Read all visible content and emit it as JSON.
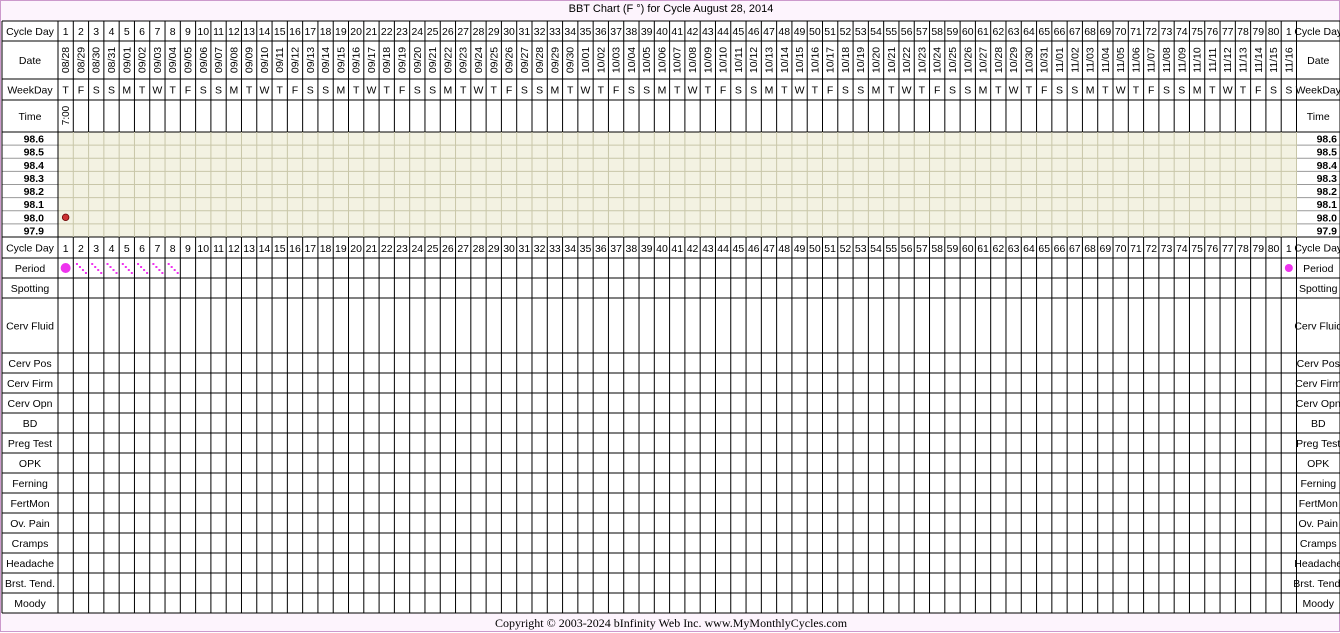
{
  "title": "BBT Chart (F °) for Cycle August 28, 2014",
  "copyright": "Copyright © 2003-2024 bInfinity Web Inc.     www.MyMonthlyCycles.com",
  "colors": {
    "frame": "#cc99cc",
    "temp_band": "#f3f2e2",
    "temp_grid": "#c8c6a8",
    "grid": "#000000",
    "period": "#ee33ee",
    "temp_point": "#cc3333"
  },
  "row_labels": {
    "cycle_day": "Cycle Day",
    "date": "Date",
    "weekday": "WeekDay",
    "time": "Time",
    "period": "Period",
    "spotting": "Spotting",
    "cerv_fluid": "Cerv Fluid",
    "cerv_pos": "Cerv Pos",
    "cerv_firm": "Cerv Firm",
    "cerv_opn": "Cerv Opn",
    "bd": "BD",
    "preg_test": "Preg Test",
    "opk": "OPK",
    "ferning": "Ferning",
    "fertmon": "FertMon",
    "ov_pain": "Ov. Pain",
    "cramps": "Cramps",
    "headache": "Headache",
    "brst_tend": "Brst. Tend.",
    "moody": "Moody"
  },
  "temp_scale": [
    "98.6",
    "98.5",
    "98.4",
    "98.3",
    "98.2",
    "98.1",
    "98.0",
    "97.9"
  ],
  "cycle_days": [
    "1",
    "2",
    "3",
    "4",
    "5",
    "6",
    "7",
    "8",
    "9",
    "10",
    "11",
    "12",
    "13",
    "14",
    "15",
    "16",
    "17",
    "18",
    "19",
    "20",
    "21",
    "22",
    "23",
    "24",
    "25",
    "26",
    "27",
    "28",
    "29",
    "30",
    "31",
    "32",
    "33",
    "34",
    "35",
    "36",
    "37",
    "38",
    "39",
    "40",
    "41",
    "42",
    "43",
    "44",
    "45",
    "46",
    "47",
    "48",
    "49",
    "50",
    "51",
    "52",
    "53",
    "54",
    "55",
    "56",
    "57",
    "58",
    "59",
    "60",
    "61",
    "62",
    "63",
    "64",
    "65",
    "66",
    "67",
    "68",
    "69",
    "70",
    "71",
    "72",
    "73",
    "74",
    "75",
    "76",
    "77",
    "78",
    "79",
    "80",
    "1"
  ],
  "dates": [
    "08/28",
    "08/29",
    "08/30",
    "08/31",
    "09/01",
    "09/02",
    "09/03",
    "09/04",
    "09/05",
    "09/06",
    "09/07",
    "09/08",
    "09/09",
    "09/10",
    "09/11",
    "09/12",
    "09/13",
    "09/14",
    "09/15",
    "09/16",
    "09/17",
    "09/18",
    "09/19",
    "09/20",
    "09/21",
    "09/22",
    "09/23",
    "09/24",
    "09/25",
    "09/26",
    "09/27",
    "09/28",
    "09/29",
    "09/30",
    "10/01",
    "10/02",
    "10/03",
    "10/04",
    "10/05",
    "10/06",
    "10/07",
    "10/08",
    "10/09",
    "10/10",
    "10/11",
    "10/12",
    "10/13",
    "10/14",
    "10/15",
    "10/16",
    "10/17",
    "10/18",
    "10/19",
    "10/20",
    "10/21",
    "10/22",
    "10/23",
    "10/24",
    "10/25",
    "10/26",
    "10/27",
    "10/28",
    "10/29",
    "10/30",
    "10/31",
    "11/01",
    "11/02",
    "11/03",
    "11/04",
    "11/05",
    "11/06",
    "11/07",
    "11/08",
    "11/09",
    "11/10",
    "11/11",
    "11/12",
    "11/13",
    "11/14",
    "11/15",
    "11/16"
  ],
  "weekdays": [
    "T",
    "F",
    "S",
    "S",
    "M",
    "T",
    "W",
    "T",
    "F",
    "S",
    "S",
    "M",
    "T",
    "W",
    "T",
    "F",
    "S",
    "S",
    "M",
    "T",
    "W",
    "T",
    "F",
    "S",
    "S",
    "M",
    "T",
    "W",
    "T",
    "F",
    "S",
    "S",
    "M",
    "T",
    "W",
    "T",
    "F",
    "S",
    "S",
    "M",
    "T",
    "W",
    "T",
    "F",
    "S",
    "S",
    "M",
    "T",
    "W",
    "T",
    "F",
    "S",
    "S",
    "M",
    "T",
    "W",
    "T",
    "F",
    "S",
    "S",
    "M",
    "T",
    "W",
    "T",
    "F",
    "S",
    "S",
    "M",
    "T",
    "W",
    "T",
    "F",
    "S",
    "S",
    "M",
    "T",
    "W",
    "T",
    "F",
    "S",
    "S"
  ],
  "chart_data": {
    "type": "scatter",
    "title": "BBT Chart (F °) for Cycle August 28, 2014",
    "y_ticks": [
      98.6,
      98.5,
      98.4,
      98.3,
      98.2,
      98.1,
      98.0,
      97.9
    ],
    "ylim": [
      97.9,
      98.6
    ],
    "temperatures": [
      {
        "day_index": 0,
        "time": "7:00",
        "value": 98.0
      }
    ],
    "period": [
      {
        "day_index": 0,
        "type": "heavy"
      },
      {
        "day_index": 1,
        "type": "light"
      },
      {
        "day_index": 2,
        "type": "light"
      },
      {
        "day_index": 3,
        "type": "light"
      },
      {
        "day_index": 4,
        "type": "light"
      },
      {
        "day_index": 5,
        "type": "light"
      },
      {
        "day_index": 6,
        "type": "light"
      },
      {
        "day_index": 7,
        "type": "light"
      },
      {
        "day_index": 80,
        "type": "medium"
      }
    ]
  }
}
